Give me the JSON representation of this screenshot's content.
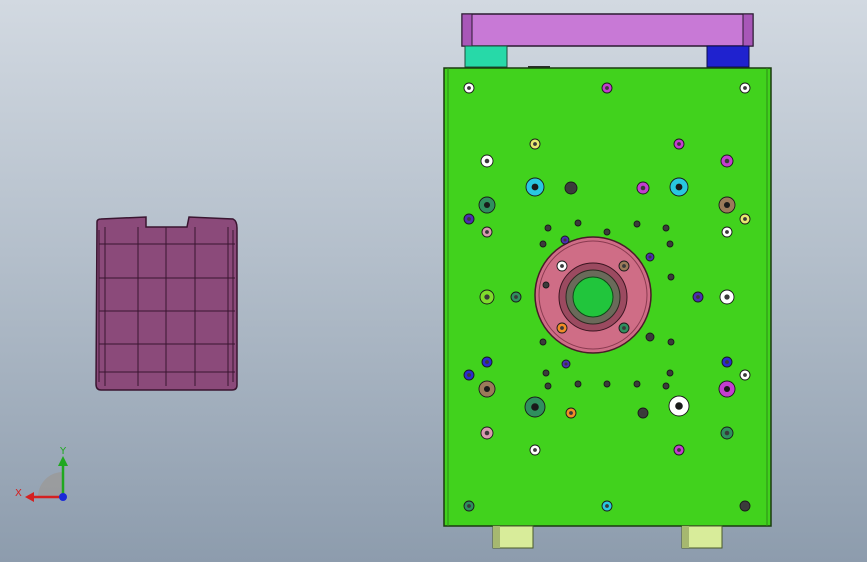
{
  "viewport": {
    "background_top": "#d2d9e1",
    "background_bottom": "#8d9cad"
  },
  "triad": {
    "x_label": "X",
    "y_label": "Y",
    "x_color": "#d42020",
    "y_color": "#1fa81f",
    "z_color": "#1a2ad8"
  },
  "part_model": {
    "fill": "#8b4a7a",
    "edge": "#3a1530"
  },
  "mold_plate": {
    "plate_fill": "#41d21d",
    "top_bar_fill": "#c879d6",
    "left_block_fill": "#27d9a8",
    "right_block_fill": "#1f22cf",
    "ring_fill": "#cf6d86",
    "sprue_fill": "#21c53c",
    "guide_pin_fill": "#d8ec9a"
  },
  "hole_palette": [
    "#ffffff",
    "#c43dd0",
    "#e8e870",
    "#29c7e0",
    "#2f8f5e",
    "#4b2db3",
    "#d99ab0",
    "#f28c28",
    "#2b2bd0",
    "#9b7a5a",
    "#7fdc2c",
    "#3b3b3b"
  ]
}
